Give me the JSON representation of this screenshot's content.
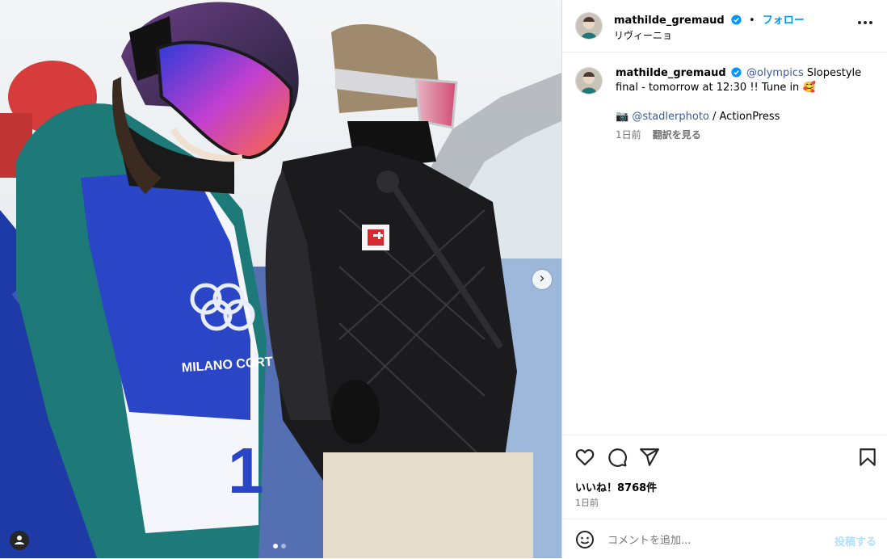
{
  "post": {
    "username": "mathilde_gremaud",
    "follow_label": "フォロー",
    "location": "リヴィーニョ",
    "more_label": "…"
  },
  "caption": {
    "username": "mathilde_gremaud",
    "mention1": "@olympics",
    "text1": " Slopestyle final - tomorrow at 12:30 !! Tune in ",
    "emoji": "🥰",
    "camera": "📷",
    "mention2": "@stadlerphoto",
    "credit": " / ActionPress",
    "time": "1日前",
    "translate": "翻訳を見る"
  },
  "media": {
    "bib_text": "MILANO CORT",
    "bib_number": "1",
    "next_arrow": "›",
    "dots": 2
  },
  "actions": {
    "icons": [
      "heart-icon",
      "comment-icon",
      "share-icon",
      "bookmark-icon"
    ]
  },
  "likes": {
    "text": "いいね！8768件",
    "time": "1日前"
  },
  "comment": {
    "placeholder": "コメントを追加...",
    "post_label": "投稿する"
  },
  "colors": {
    "accent": "#0095f6",
    "link": "#3a5b9a",
    "verified": "#0095f6"
  }
}
